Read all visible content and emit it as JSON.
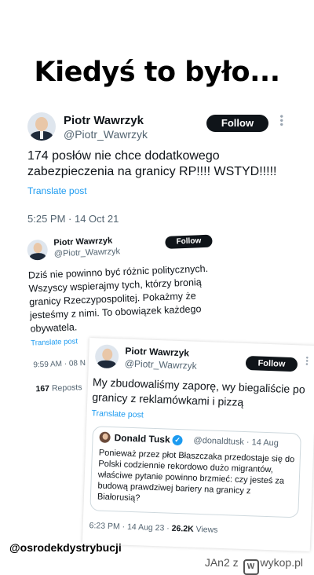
{
  "headline": "Kiedyś to było...",
  "tweet1": {
    "name": "Piotr Wawrzyk",
    "handle": "@Piotr_Wawrzyk",
    "follow_label": "Follow",
    "text_lines": [
      "174 posłów nie chce dodatkowego",
      "zabezpieczenia na granicy RP!!!! WSTYD!!!!!"
    ],
    "translate": "Translate post",
    "meta": "5:25 PM · 14 Oct 21"
  },
  "tweet2": {
    "name": "Piotr Wawrzyk",
    "handle": "@Piotr_Wawrzyk",
    "follow_label": "Follow",
    "text_lines": [
      "Dziś nie powinno być różnic politycznych.",
      "Wszyscy wspierajmy tych, którzy bronią",
      "granicy Rzeczypospolitej.  Pokażmy że",
      "jesteśmy z nimi. To obowiązek każdego",
      "obywatela."
    ],
    "translate": "Translate post",
    "meta": "9:59 AM · 08 N",
    "reposts_count": "167",
    "reposts_label": "Reposts"
  },
  "tweet3": {
    "name": "Piotr Wawrzyk",
    "handle": "@Piotr_Wawrzyk",
    "follow_label": "Follow",
    "text_lines": [
      "My zbudowaliśmy zaporę, wy biegaliście po",
      "granicy z reklamówkami i pizzą"
    ],
    "translate": "Translate post",
    "quote": {
      "name": "Donald Tusk",
      "handle": "@donaldtusk · 14 Aug",
      "text_lines": [
        "Ponieważ przez płot Błaszczaka przedostaje się do",
        "Polski codziennie rekordowo dużo migrantów,",
        "właściwe pytanie powinno brzmieć: czy jesteś za",
        "budową prawdziwej bariery na granicy z",
        "Białorusią?"
      ]
    },
    "meta_time": "6:23 PM · 14 Aug 23 · ",
    "views_count": "26.2K",
    "views_label": "Views"
  },
  "footer": {
    "source_handle": "@osrodekdystrybucji",
    "user": "JAn2",
    "separator": "z",
    "site": "wykop.pl",
    "logo_glyph": "W"
  },
  "icons": {
    "more": "more-dots-icon",
    "verified": "verified-badge-icon",
    "site_logo": "wykop-logo-icon"
  },
  "colors": {
    "link": "#1d9bf0",
    "button": "#0f1419",
    "muted": "#536471"
  }
}
